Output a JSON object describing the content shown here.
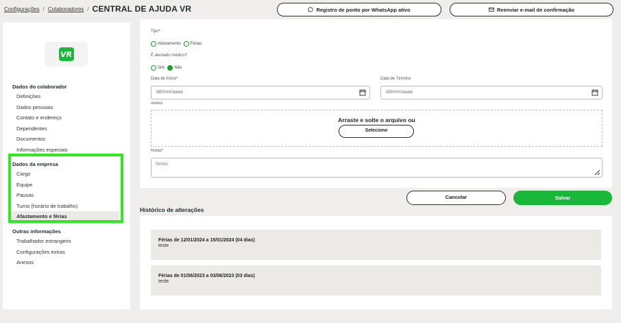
{
  "breadcrumb": {
    "items": [
      "Configurações",
      "Colaboradores"
    ],
    "separator": "/",
    "title": "CENTRAL DE AJUDA VR"
  },
  "header_buttons": {
    "whatsapp": "Registro de ponto por WhatsApp ativo",
    "email": "Reenviar e-mail de confirmação"
  },
  "logo": {
    "text": "VR",
    "color": "#1ab83a"
  },
  "sidebar": {
    "group1": {
      "title": "Dados do colaborador",
      "items": [
        "Definições",
        "Dados pessoais",
        "Contato e endereço",
        "Dependentes",
        "Documentos",
        "Informações especiais"
      ]
    },
    "group2": {
      "title": "Dados da empresa",
      "items": [
        "Cargo",
        "Equipe",
        "Pausas",
        "Turno (horário de trabalho)",
        "Afastamento e férias"
      ],
      "active": "Afastamento e férias"
    },
    "group3": {
      "title": "Outras informações",
      "items": [
        "Trabalhador estrangeiro",
        "Configurações extras",
        "Anexos"
      ]
    }
  },
  "form": {
    "tipo_label": "Tipo*",
    "tipo_options": [
      "Afastamento",
      "Férias"
    ],
    "atestado_label": "É atestado médico?",
    "atestado_options": [
      "Sim",
      "Não"
    ],
    "atestado_selected": "Não",
    "inicio_label": "Data de Início*",
    "inicio_placeholder": "dd/mm/aaaa",
    "termino_label": "Data de Término",
    "termino_placeholder": "dd/mm/aaaa",
    "anexo_label": "Anexo",
    "dropzone_text": "Arraste e solte o arquivo ou",
    "select_button": "Selecione",
    "notas_label": "Notas*",
    "notas_placeholder": "Notas"
  },
  "actions": {
    "cancel": "Cancelar",
    "save": "Salvar"
  },
  "history": {
    "title": "Histórico de alterações",
    "items": [
      {
        "period": "Férias de 12/01/2024 a 15/01/2024 (04 dias)",
        "note": "teste"
      },
      {
        "period": "Férias de 01/06/2023 a 03/06/2023 (03 dias)",
        "note": "teste"
      }
    ]
  },
  "colors": {
    "accent": "#1ab83a",
    "highlight": "#31e81f"
  }
}
